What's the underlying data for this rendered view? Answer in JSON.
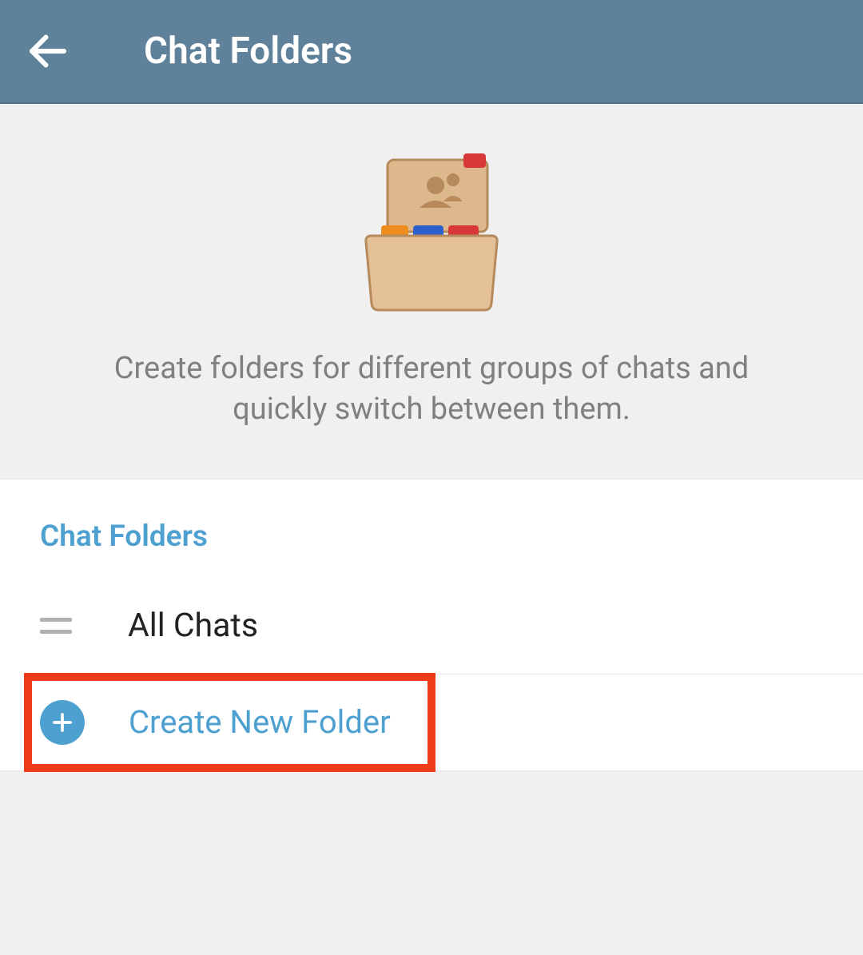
{
  "header": {
    "title": "Chat Folders"
  },
  "hero": {
    "description": "Create folders for different groups of chats and quickly switch between them."
  },
  "section": {
    "title": "Chat Folders",
    "items": [
      {
        "label": "All Chats"
      }
    ],
    "create_label": "Create New Folder"
  },
  "colors": {
    "accent": "#4da0d0",
    "header_bg": "#5f819a",
    "highlight": "#ee3b1a"
  }
}
